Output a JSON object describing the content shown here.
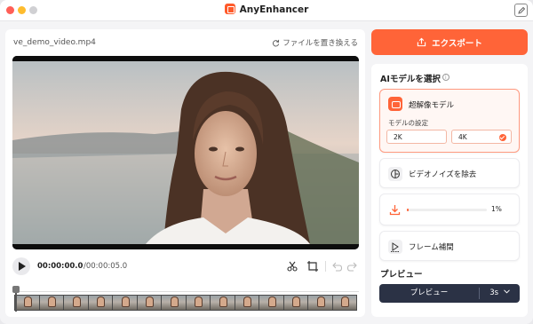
{
  "app": {
    "title": "AnyEnhancer"
  },
  "colors": {
    "accent": "#ff6438",
    "dark": "#2b3245"
  },
  "left": {
    "filename": "ve_demo_video.mp4",
    "replace_label": "ファイルを置き換える",
    "time_current": "00:00:00.0",
    "time_total": "/00:00:05.0"
  },
  "right": {
    "export_label": "エクスポート",
    "ai_model_title": "AIモデルを選択",
    "models": {
      "super_resolution": "超解像モデル",
      "setting_label": "モデルの設定",
      "option_2k": "2K",
      "option_4k": "4K",
      "selected": "4K",
      "denoise": "ビデオノイズを除去",
      "progress_value": "1%",
      "progress_fraction": 0.01,
      "frame_interp": "フレーム補間"
    },
    "preview_title": "プレビュー",
    "preview_button": "プレビュー",
    "duration": "3s"
  },
  "icons": [
    "edit-icon",
    "refresh-icon",
    "play-icon",
    "scissors-icon",
    "crop-icon",
    "undo-icon",
    "redo-icon",
    "upload-icon",
    "info-icon",
    "super-resolution-icon",
    "denoise-icon",
    "download-icon",
    "frame-interpolation-icon",
    "chevron-down-icon"
  ]
}
